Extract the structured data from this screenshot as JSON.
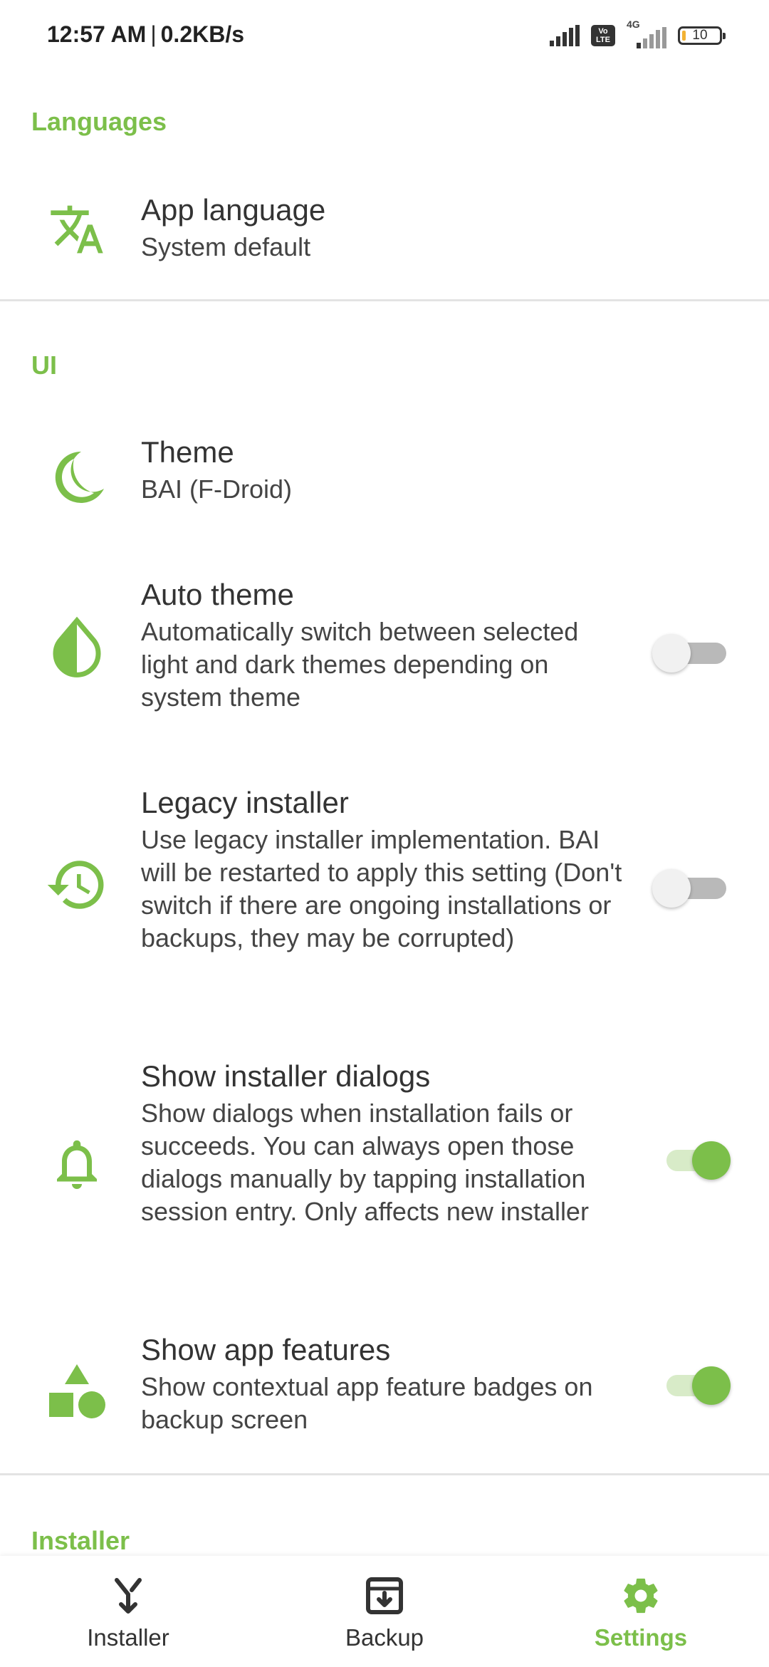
{
  "status_bar": {
    "time": "12:57 AM",
    "separator": "|",
    "net_rate": "0.2KB/s",
    "volte_top": "Vo",
    "volte_bottom": "LTE",
    "network_type": "4G",
    "battery_level": "10",
    "icons": [
      "signal-icon",
      "volte-icon",
      "signal-4g-icon",
      "battery-icon"
    ]
  },
  "colors": {
    "accent": "#7cbf4a",
    "text": "#333333",
    "divider": "#e3e3e3"
  },
  "sections": {
    "languages": {
      "header": "Languages",
      "items": [
        {
          "title": "App language",
          "summary": "System default",
          "icon": "translate-icon"
        }
      ]
    },
    "ui": {
      "header": "UI",
      "items": [
        {
          "title": "Theme",
          "summary": "BAI (F-Droid)",
          "icon": "moon-icon"
        },
        {
          "title": "Auto theme",
          "summary": "Automatically switch between selected light and dark themes depending on system theme",
          "icon": "contrast-drop-icon",
          "switch_on": false
        },
        {
          "title": "Legacy installer",
          "summary": "Use legacy installer implementation. BAI will be restarted to apply this setting (Don't switch if there are ongoing installations or backups, they may be corrupted)",
          "icon": "history-icon",
          "switch_on": false
        },
        {
          "title": "Show installer dialogs",
          "summary": "Show dialogs when installation fails or succeeds. You can always open those dialogs manually by tapping installation session entry. Only affects new installer",
          "icon": "bell-icon",
          "switch_on": true
        },
        {
          "title": "Show app features",
          "summary": "Show contextual app feature badges on backup screen",
          "icon": "shapes-icon",
          "switch_on": true
        }
      ]
    },
    "installer": {
      "header": "Installer"
    }
  },
  "bottom_nav": {
    "items": [
      {
        "label": "Installer",
        "icon": "merge-arrow-icon",
        "active": false
      },
      {
        "label": "Backup",
        "icon": "archive-icon",
        "active": false
      },
      {
        "label": "Settings",
        "icon": "gear-icon",
        "active": true
      }
    ]
  }
}
